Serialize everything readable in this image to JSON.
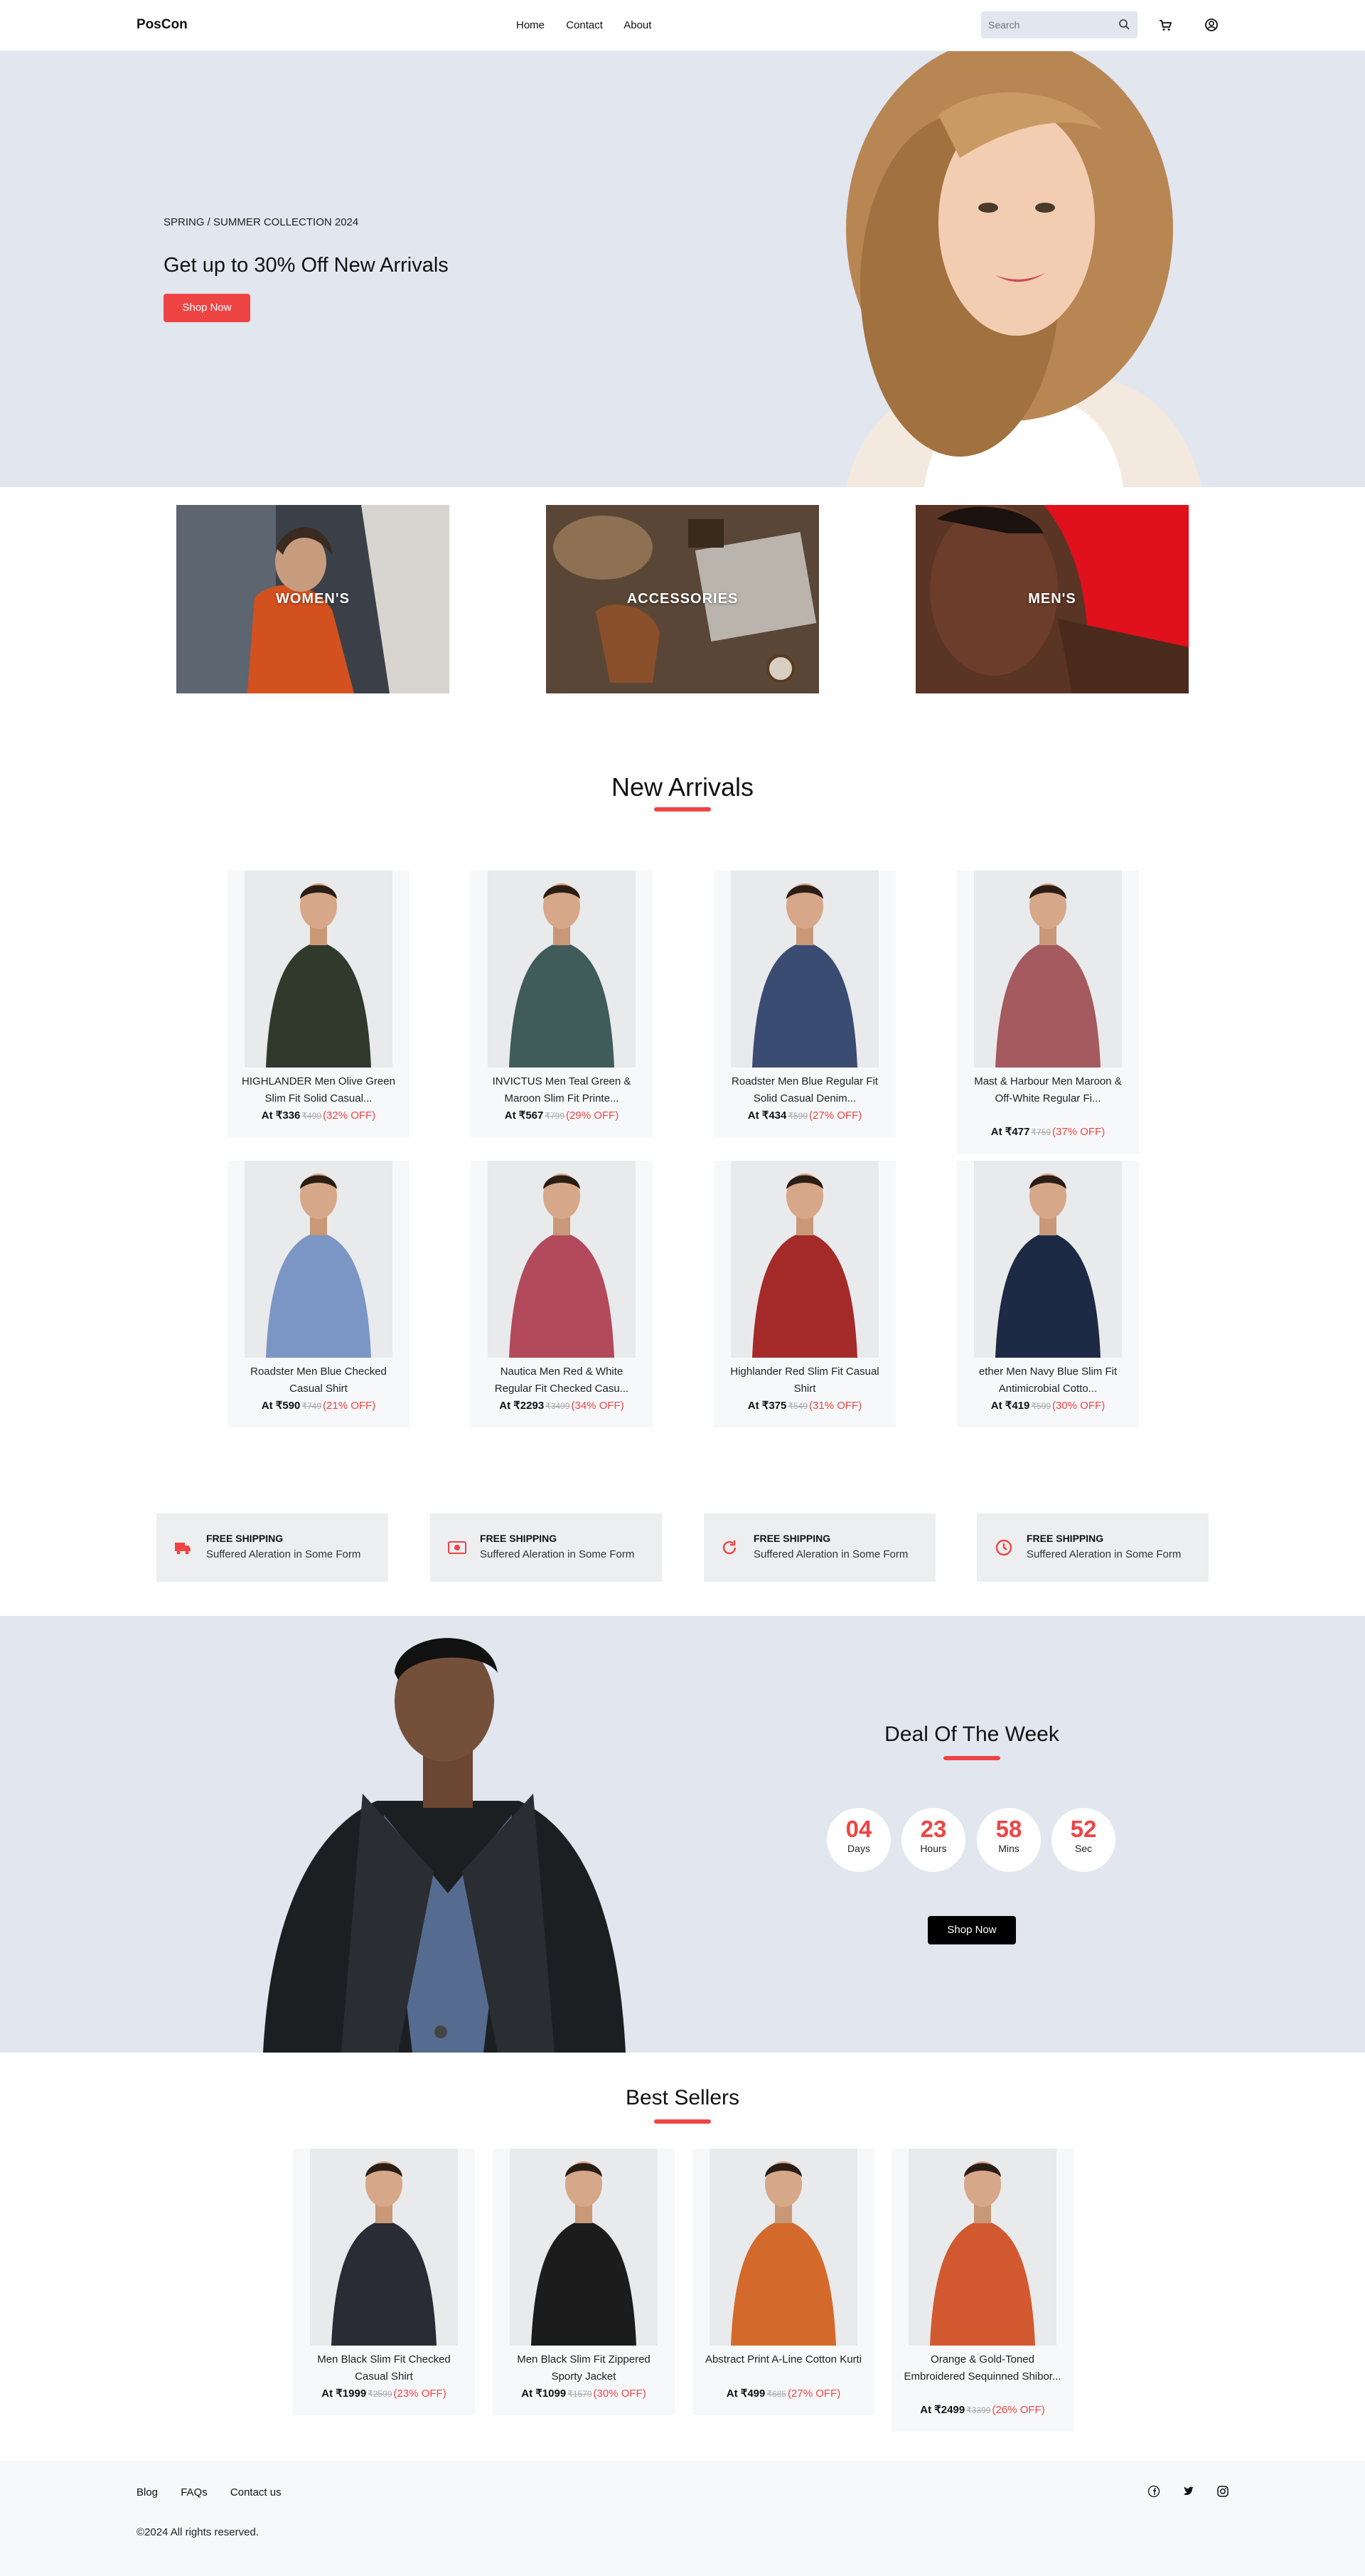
{
  "nav": {
    "logo": "PosCon",
    "links": [
      "Home",
      "Contact",
      "About"
    ],
    "search_placeholder": "Search",
    "icons": [
      "search-icon",
      "cart-icon",
      "user-icon"
    ]
  },
  "hero": {
    "subtitle": "SPRING / SUMMER COLLECTION 2024",
    "title": "Get up to 30% Off New Arrivals",
    "cta": "Shop Now"
  },
  "categories": [
    "WOMEN'S",
    "ACCESSORIES",
    "MEN'S"
  ],
  "new_arrivals": {
    "title": "New Arrivals",
    "products": [
      {
        "name": "HIGHLANDER Men Olive Green Slim Fit Solid Casual...",
        "price": "At ₹336",
        "old": "₹499",
        "off": "(32% OFF)"
      },
      {
        "name": "INVICTUS Men Teal Green & Maroon Slim Fit Printe...",
        "price": "At ₹567",
        "old": "₹799",
        "off": "(29% OFF)"
      },
      {
        "name": "Roadster Men Blue Regular Fit Solid Casual Denim...",
        "price": "At ₹434",
        "old": "₹599",
        "off": "(27% OFF)"
      },
      {
        "name": "Mast & Harbour Men Maroon & Off-White Regular Fi...",
        "price": "At ₹477",
        "old": "₹759",
        "off": "(37% OFF)"
      },
      {
        "name": "Roadster Men Blue Checked Casual Shirt",
        "price": "At ₹590",
        "old": "₹749",
        "off": "(21% OFF)"
      },
      {
        "name": "Nautica Men Red & White Regular Fit Checked Casu...",
        "price": "At ₹2293",
        "old": "₹3499",
        "off": "(34% OFF)"
      },
      {
        "name": "Highlander Red Slim Fit Casual Shirt",
        "price": "At ₹375",
        "old": "₹549",
        "off": "(31% OFF)"
      },
      {
        "name": "ether Men Navy Blue Slim Fit Antimicrobial Cotto...",
        "price": "At ₹419",
        "old": "₹599",
        "off": "(30% OFF)"
      }
    ]
  },
  "features": [
    {
      "title": "FREE SHIPPING",
      "text": "Suffered Aleration in Some Form",
      "icon": "truck-icon"
    },
    {
      "title": "FREE SHIPPING",
      "text": "Suffered Aleration in Some Form",
      "icon": "money-icon"
    },
    {
      "title": "FREE SHIPPING",
      "text": "Suffered Aleration in Some Form",
      "icon": "refresh-icon"
    },
    {
      "title": "FREE SHIPPING",
      "text": "Suffered Aleration in Some Form",
      "icon": "clock-icon"
    }
  ],
  "deal": {
    "title": "Deal Of The Week",
    "countdown": [
      {
        "value": "04",
        "label": "Days"
      },
      {
        "value": "23",
        "label": "Hours"
      },
      {
        "value": "58",
        "label": "Mins"
      },
      {
        "value": "52",
        "label": "Sec"
      }
    ],
    "cta": "Shop Now"
  },
  "best_sellers": {
    "title": "Best Sellers",
    "products": [
      {
        "name": "Men Black Slim Fit Checked Casual Shirt",
        "price": "At ₹1999",
        "old": "₹2599",
        "off": "(23% OFF)"
      },
      {
        "name": "Men Black Slim Fit Zippered Sporty Jacket",
        "price": "At ₹1099",
        "old": "₹1570",
        "off": "(30% OFF)"
      },
      {
        "name": "Abstract Print A-Line Cotton Kurti",
        "price": "At ₹499",
        "old": "₹685",
        "off": "(27% OFF)"
      },
      {
        "name": "Orange & Gold-Toned Embroidered Sequinned Shibor...",
        "price": "At ₹2499",
        "old": "₹3399",
        "off": "(26% OFF)"
      }
    ]
  },
  "footer": {
    "links": [
      "Blog",
      "FAQs",
      "Contact us"
    ],
    "copyright": "©2024 All rights reserved.",
    "social": [
      "facebook-icon",
      "twitter-icon",
      "instagram-icon"
    ]
  },
  "colors": {
    "accent": "#ef4444",
    "hero_bg": "#e1e6ef",
    "card_bg": "#f7f8fa"
  }
}
